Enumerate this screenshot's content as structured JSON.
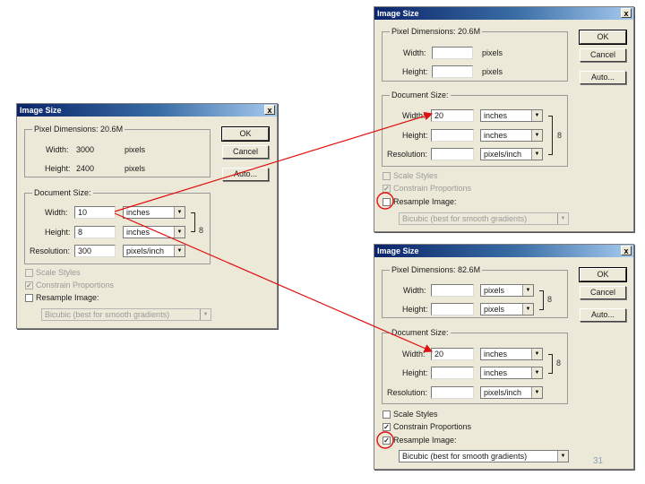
{
  "common": {
    "title": "Image Size",
    "ok": "OK",
    "cancel": "Cancel",
    "auto": "Auto...",
    "pixel_group": "Pixel Dimensions:",
    "doc_group": "Document Size:",
    "width_label": "Width:",
    "height_label": "Height:",
    "resolution_label": "Resolution:",
    "scale_styles": "Scale Styles",
    "constrain": "Constrain Proportions",
    "resample": "Resample Image:",
    "resample_method": "Bicubic (best for smooth gradients)",
    "close": "x",
    "chain": "8",
    "arrow": "▼"
  },
  "dialog_left": {
    "pixel_size": "20.6M",
    "pixel_width": "3000",
    "pixel_height": "2400",
    "pixel_unit": "pixels",
    "doc_width": "10",
    "doc_height": "8",
    "resolution": "300",
    "doc_width_unit": "inches",
    "doc_height_unit": "inches",
    "resolution_unit": "pixels/inch",
    "scale_styles_checked": true,
    "constrain_checked": true,
    "resample_checked": false
  },
  "dialog_top_right": {
    "pixel_size": "20.6M",
    "pixel_unit": "pixels",
    "doc_width": "20",
    "doc_height": "",
    "resolution": "",
    "doc_width_unit": "inches",
    "doc_height_unit": "inches",
    "resolution_unit": "pixels/inch",
    "scale_styles_checked": true,
    "constrain_checked": true,
    "resample_checked": false
  },
  "dialog_bottom_right": {
    "pixel_size": "82.6M",
    "pixel_unit": "pixels",
    "doc_width": "20",
    "doc_width_unit": "inches",
    "doc_height_unit": "inches",
    "resolution_unit": "pixels/inch",
    "scale_styles_checked": false,
    "constrain_checked": true,
    "resample_checked": true
  },
  "page_number": "31",
  "colors": {
    "annotation": "#e01010",
    "title_start": "#0a246a",
    "title_end": "#a6caf0"
  }
}
